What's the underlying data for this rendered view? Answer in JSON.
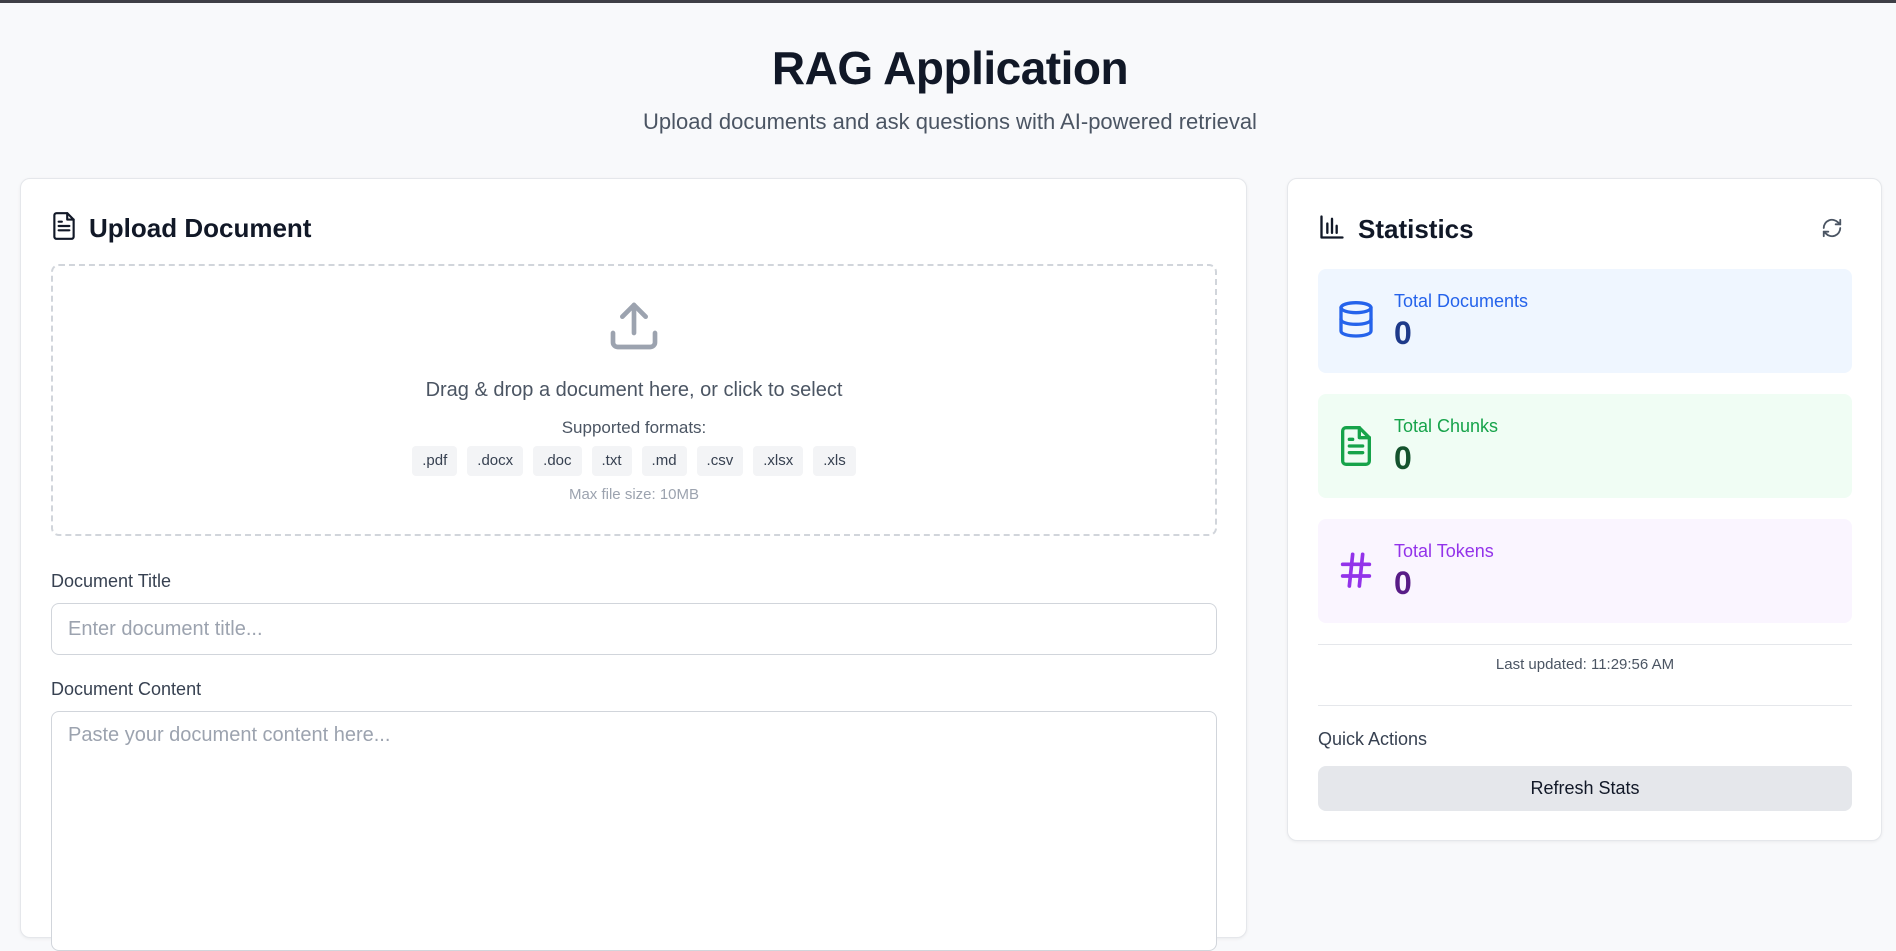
{
  "header": {
    "title": "RAG Application",
    "subtitle": "Upload documents and ask questions with AI-powered retrieval"
  },
  "upload": {
    "title": "Upload Document",
    "dropzone_text": "Drag & drop a document here, or click to select",
    "formats_label": "Supported formats:",
    "formats": [
      ".pdf",
      ".docx",
      ".doc",
      ".txt",
      ".md",
      ".csv",
      ".xlsx",
      ".xls"
    ],
    "max_size": "Max file size: 10MB",
    "title_label": "Document Title",
    "title_placeholder": "Enter document title...",
    "title_value": "",
    "content_label": "Document Content",
    "content_placeholder": "Paste your document content here...",
    "content_value": ""
  },
  "stats": {
    "title": "Statistics",
    "total_documents_label": "Total Documents",
    "total_documents": "0",
    "total_chunks_label": "Total Chunks",
    "total_chunks": "0",
    "total_tokens_label": "Total Tokens",
    "total_tokens": "0",
    "last_updated": "Last updated: 11:29:56 AM",
    "quick_actions_label": "Quick Actions",
    "refresh_button": "Refresh Stats"
  },
  "colors": {
    "docs_accent": "#2563eb",
    "chunks_accent": "#16a34a",
    "tokens_accent": "#9333ea"
  },
  "icons": {
    "upload_title": "document-icon",
    "dropzone": "upload-icon",
    "stats_title": "bar-chart-icon",
    "refresh": "refresh-icon",
    "documents": "database-icon",
    "chunks": "file-text-icon",
    "tokens": "hash-icon"
  }
}
